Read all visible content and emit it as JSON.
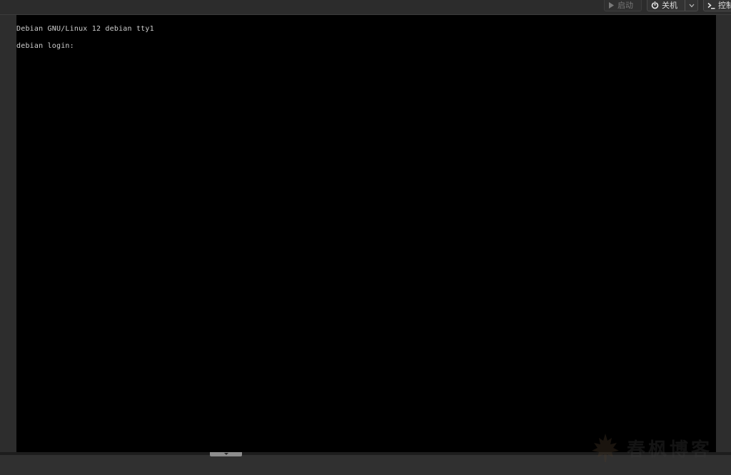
{
  "toolbar": {
    "start_label": "启动",
    "shutdown_label": "关机",
    "console_label": "控制台",
    "start_icon": "play-icon",
    "shutdown_icon": "power-icon",
    "shutdown_menu_icon": "chevron-down-icon",
    "console_icon": "terminal-icon"
  },
  "console": {
    "lines": [
      "Debian GNU/Linux 12 debian tty1",
      "debian login:"
    ]
  },
  "bottom": {
    "handle_icon": "chevron-down-icon"
  },
  "watermark": {
    "text": "春枫博客",
    "icon": "maple-leaf-icon"
  },
  "colors": {
    "console_bg": "#000000",
    "console_text": "#cfcfcf",
    "chrome_bg": "#2d2d2d"
  }
}
